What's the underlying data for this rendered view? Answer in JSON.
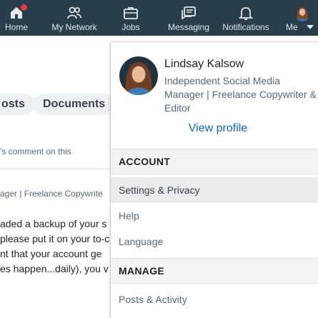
{
  "nav": {
    "items": [
      {
        "label": "Home",
        "icon": "home-icon"
      },
      {
        "label": "My Network",
        "icon": "network-icon"
      },
      {
        "label": "Jobs",
        "icon": "briefcase-icon"
      },
      {
        "label": "Messaging",
        "icon": "messaging-icon"
      },
      {
        "label": "Notifications",
        "icon": "bell-icon"
      },
      {
        "label": "Me",
        "icon": "avatar"
      }
    ]
  },
  "feed": {
    "pills": [
      "osts",
      "Documents"
    ],
    "comment_line": "'s comment on this",
    "author_line": "ager | Freelance Copywrite",
    "body_lines": [
      "aded a backup of your s",
      "please put it on your to-c",
      "nt that your account ge",
      "es happen...daily), you v"
    ]
  },
  "dropdown": {
    "profile": {
      "name": "Lindsay Kalsow",
      "headline": "Independent Social Media Manager | Freelance Copywriter & Editor",
      "view_profile": "View profile"
    },
    "account_header": "ACCOUNT",
    "account_items": [
      "Settings & Privacy",
      "Help",
      "Language"
    ],
    "manage_header": "MANAGE",
    "manage_items": [
      "Posts & Activity"
    ]
  },
  "colors": {
    "nav_bg": "#283e4a",
    "link_blue": "#0a66c2",
    "badge_red": "#e7383d"
  }
}
